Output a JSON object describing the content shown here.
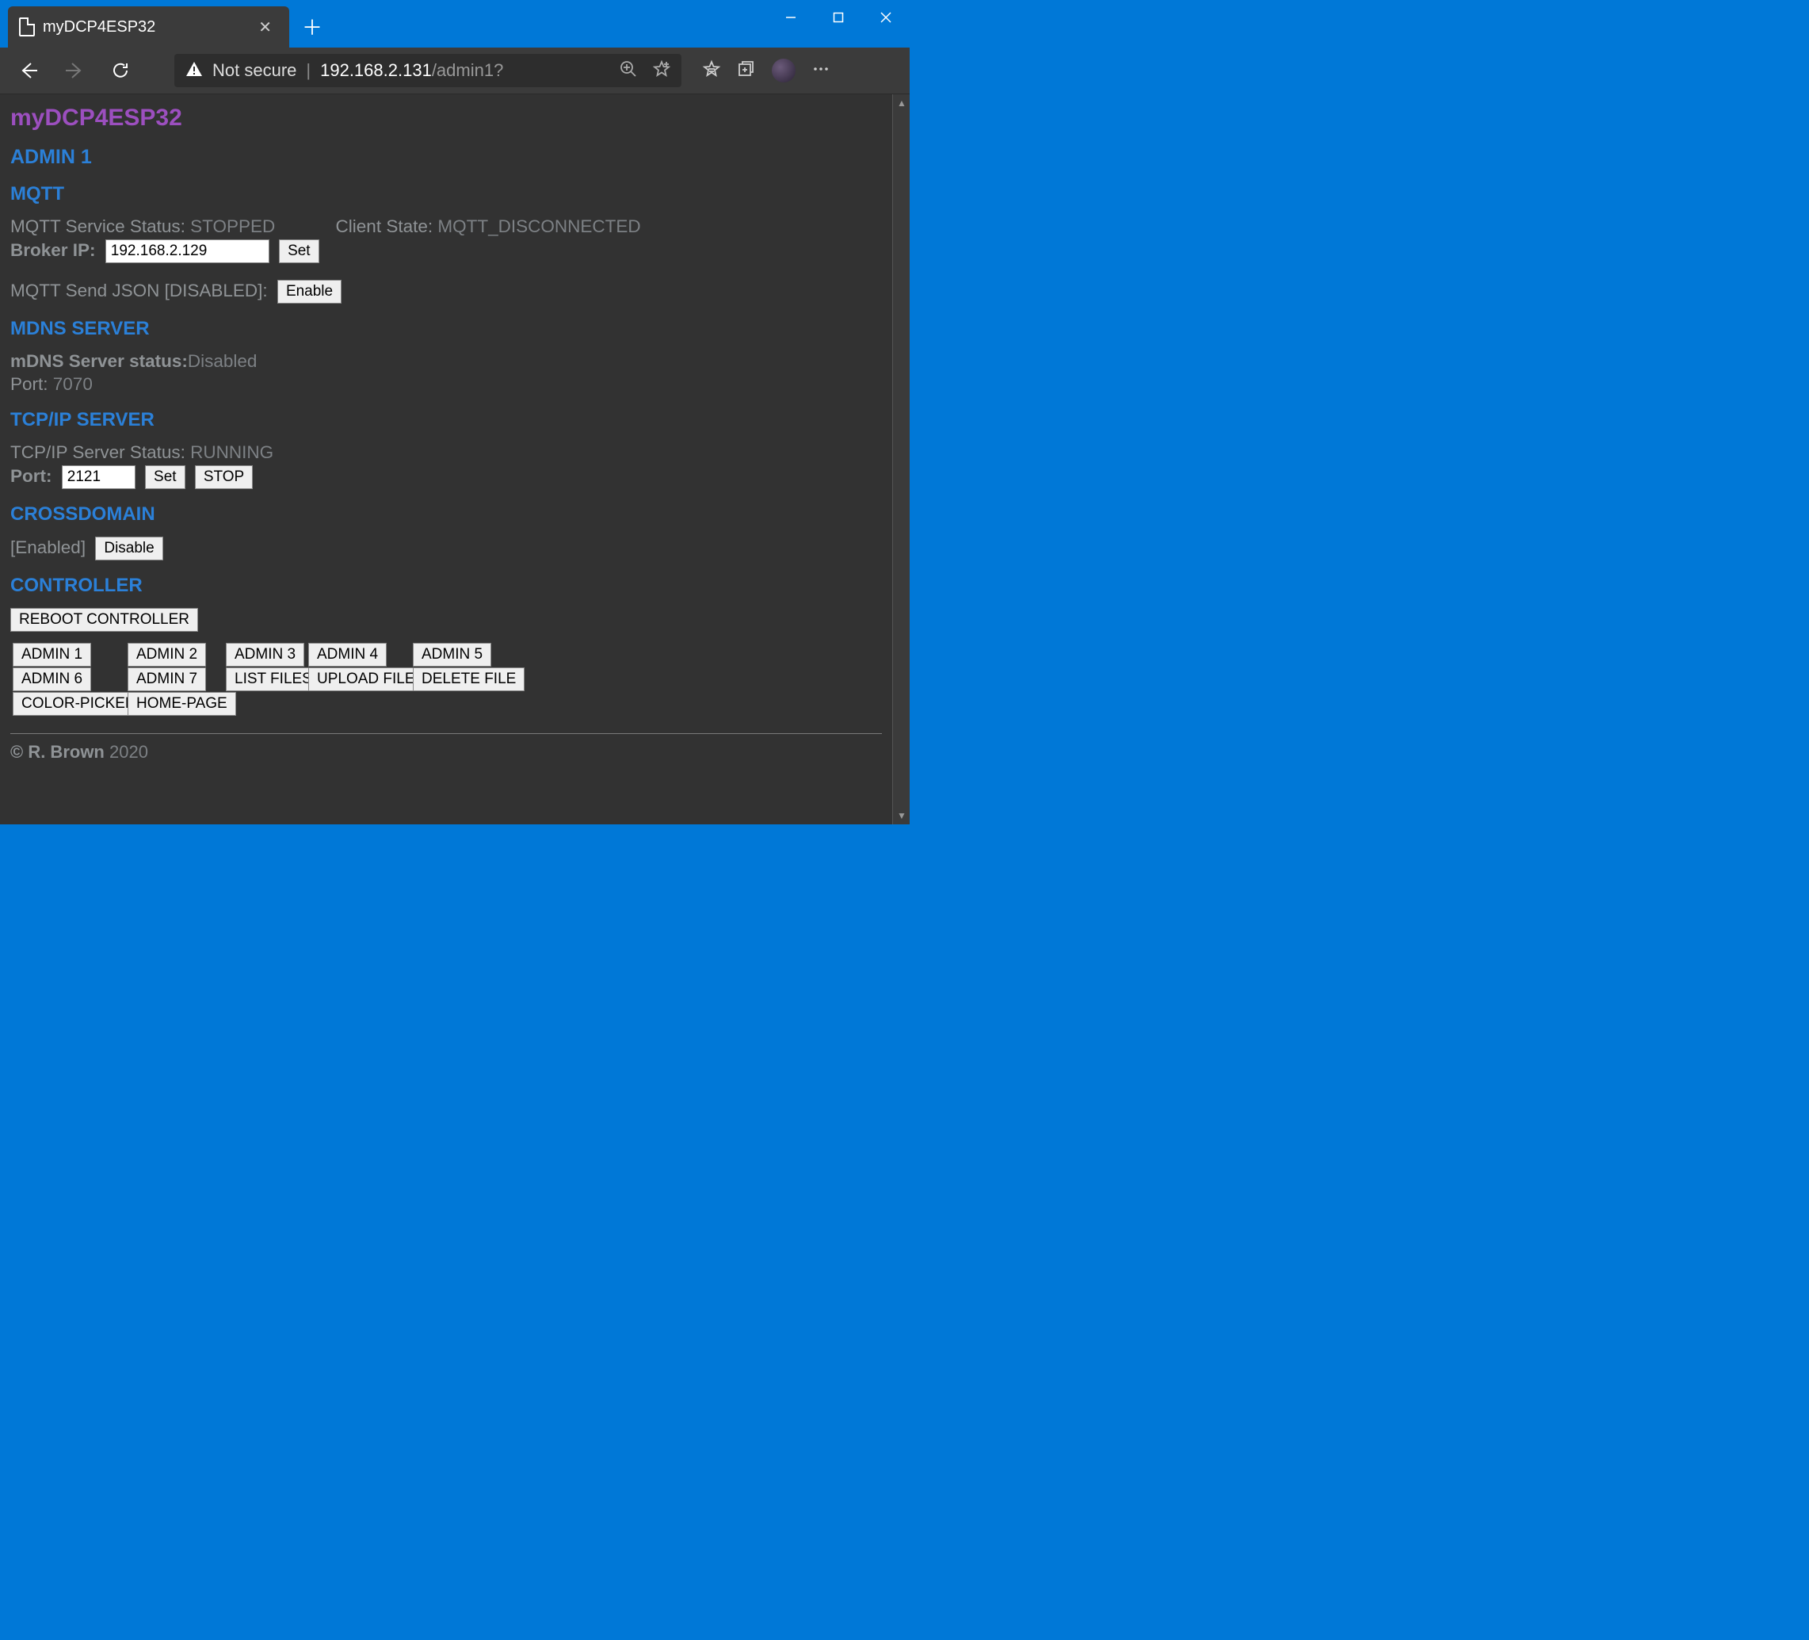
{
  "browser": {
    "tab_title": "myDCP4ESP32",
    "not_secure_label": "Not secure",
    "url_host": "192.168.2.131",
    "url_path": "/admin1?"
  },
  "page": {
    "app_title": "myDCP4ESP32",
    "admin_heading": "ADMIN 1"
  },
  "mqtt": {
    "heading": "MQTT",
    "service_status_label": "MQTT Service Status: ",
    "service_status_value": "STOPPED",
    "client_state_label": "Client State: ",
    "client_state_value": "MQTT_DISCONNECTED",
    "broker_ip_label": "Broker IP: ",
    "broker_ip_value": "192.168.2.129",
    "set_button": "Set",
    "send_json_label": "MQTT Send JSON [DISABLED]: ",
    "enable_button": "Enable"
  },
  "mdns": {
    "heading": "MDNS SERVER",
    "status_label": "mDNS Server status:",
    "status_value": "Disabled",
    "port_label": "Port: ",
    "port_value": "7070"
  },
  "tcpip": {
    "heading": "TCP/IP SERVER",
    "status_label": "TCP/IP Server Status: ",
    "status_value": "RUNNING",
    "port_label": "Port: ",
    "port_value": "2121",
    "set_button": "Set",
    "stop_button": "STOP"
  },
  "crossdomain": {
    "heading": "CROSSDOMAIN",
    "status": "[Enabled]",
    "disable_button": "Disable"
  },
  "controller": {
    "heading": "CONTROLLER",
    "reboot_button": "REBOOT CONTROLLER"
  },
  "nav": {
    "admin1": "ADMIN 1",
    "admin2": "ADMIN 2",
    "admin3": "ADMIN 3",
    "admin4": "ADMIN 4",
    "admin5": "ADMIN 5",
    "admin6": "ADMIN 6",
    "admin7": "ADMIN 7",
    "list_files": "LIST FILES",
    "upload_file": "UPLOAD FILE",
    "delete_file": "DELETE FILE",
    "color_picker": "COLOR-PICKER",
    "home_page": "HOME-PAGE"
  },
  "footer": {
    "copyright_name": "© R. Brown",
    "copyright_year": " 2020"
  }
}
